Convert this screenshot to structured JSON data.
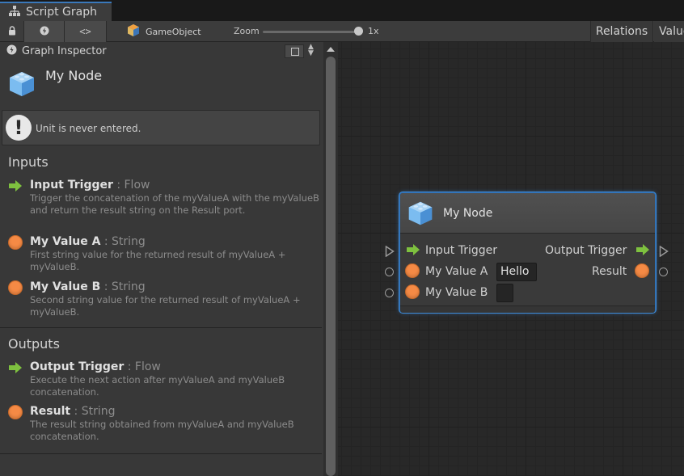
{
  "window": {
    "tab_title": "Script Graph"
  },
  "toolbar": {
    "gameobject_label": "GameObject",
    "zoom_label": "Zoom",
    "zoom_value": "1x",
    "zoom_level": 1.0,
    "relations_label": "Relations",
    "values_label": "Values"
  },
  "inspector": {
    "header": "Graph Inspector",
    "title": "My Node",
    "warning": "Unit is never entered.",
    "inputs_heading": "Inputs",
    "outputs_heading": "Outputs",
    "inputs": [
      {
        "name": "Input Trigger",
        "type": " : Flow",
        "icon": "flow-arrow-icon",
        "description": "Trigger the concatenation of the myValueA with the myValueB and return the result string on the Result port."
      },
      {
        "name": "My Value A",
        "type": " : String",
        "icon": "string-port-icon",
        "description": "First string value for the returned result of myValueA + myValueB."
      },
      {
        "name": "My Value B",
        "type": " : String",
        "icon": "string-port-icon",
        "description": "Second string value for the returned result of myValueA + myValueB."
      }
    ],
    "outputs": [
      {
        "name": "Output Trigger",
        "type": " : Flow",
        "icon": "flow-arrow-icon",
        "description": "Execute the next action after myValueA and myValueB concatenation."
      },
      {
        "name": "Result",
        "type": " : String",
        "icon": "string-port-icon",
        "description": "The result string obtained from myValueA and myValueB concatenation."
      }
    ]
  },
  "node": {
    "title": "My Node",
    "input_trigger": "Input Trigger",
    "output_trigger": "Output Trigger",
    "value_a_label": "My Value A",
    "value_a_input": "Hello",
    "value_b_label": "My Value B",
    "value_b_input": "",
    "result_label": "Result"
  },
  "colors": {
    "flow_arrow": "#7ec13f",
    "string_port": "#f58a45",
    "selection_outline": "#3f8ad6"
  }
}
